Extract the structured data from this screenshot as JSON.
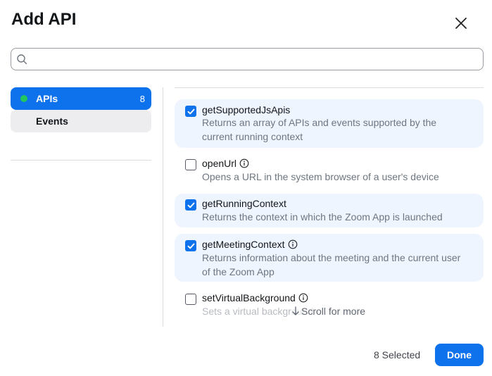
{
  "dialog": {
    "title": "Add API"
  },
  "search": {
    "value": "",
    "placeholder": ""
  },
  "nav": {
    "items": [
      {
        "label": "APIs",
        "count": "8",
        "active": true
      },
      {
        "label": "Events",
        "active": false
      }
    ]
  },
  "apis": [
    {
      "name": "getSupportedJsApis",
      "desc_line1": "Returns an array of APIs and events supported by the",
      "desc_line2": "current running context",
      "checked": true,
      "info": false
    },
    {
      "name": "openUrl",
      "desc_line1": "Opens a URL in the system browser of a user's device",
      "checked": false,
      "info": true
    },
    {
      "name": "getRunningContext",
      "desc_line1": "Returns the context in which the Zoom App is launched",
      "checked": true,
      "info": false
    },
    {
      "name": "getMeetingContext",
      "desc_line1": "Returns information about the meeting and the current user",
      "desc_line2": "of the Zoom App",
      "checked": true,
      "info": true
    },
    {
      "name": "setVirtualBackground",
      "desc_line1": "Sets a virtual background",
      "checked": false,
      "info": true
    }
  ],
  "scroll_hint": "Scroll for more",
  "footer": {
    "selected_text": "8 Selected",
    "done_label": "Done"
  },
  "colors": {
    "accent": "#0e72ed",
    "selected_row": "#eef5fe",
    "status_dot": "#22c55e"
  },
  "icons": [
    "close-icon",
    "search-icon",
    "info-icon",
    "checkmark-icon",
    "arrow-down-icon"
  ]
}
